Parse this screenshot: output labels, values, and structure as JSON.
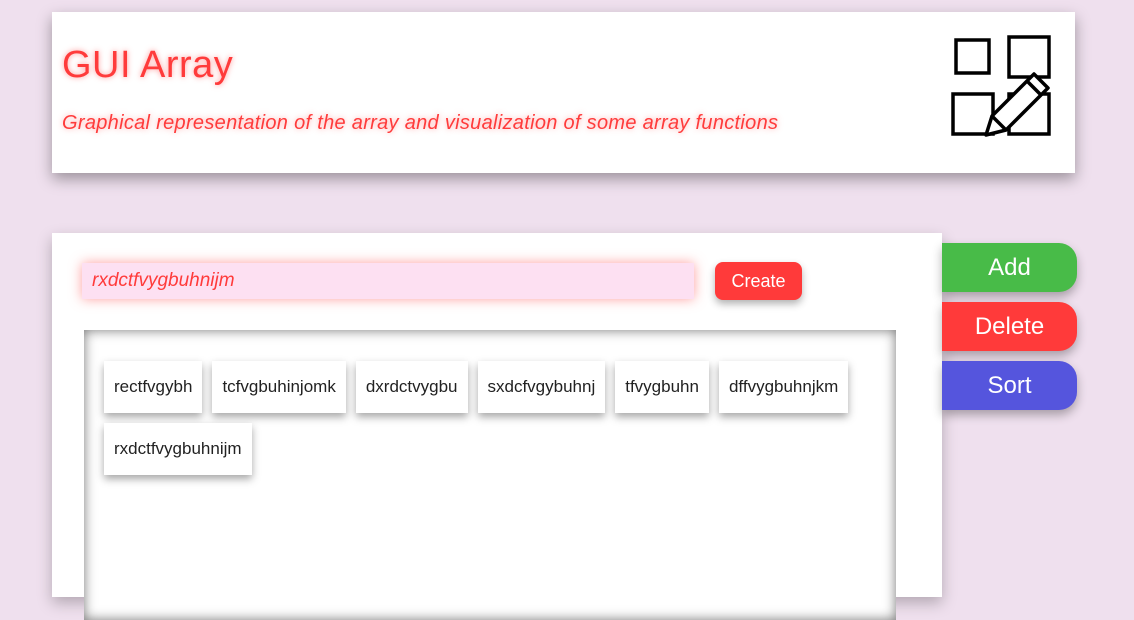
{
  "header": {
    "title": "GUI Array",
    "subtitle": "Graphical representation of the array and visualization of some array functions",
    "logo_icon": "squares-pencil-icon"
  },
  "form": {
    "input_value": "rxdctfvygbuhnijm",
    "create_label": "Create"
  },
  "array": {
    "items": [
      "rectfvgybh",
      "tcfvgbuhinjomk",
      "dxrdctvygbu",
      "sxdcfvgybuhnj",
      "tfvygbuhn",
      "dffvygbuhnjkm",
      "rxdctfvygbuhnijm"
    ]
  },
  "actions": {
    "add_label": "Add",
    "delete_label": "Delete",
    "sort_label": "Sort"
  },
  "colors": {
    "background": "#efe0ee",
    "accent_red": "#ff3a3a",
    "add_green": "#48bb48",
    "sort_blue": "#5555dd",
    "input_pink": "#fde0f2"
  }
}
